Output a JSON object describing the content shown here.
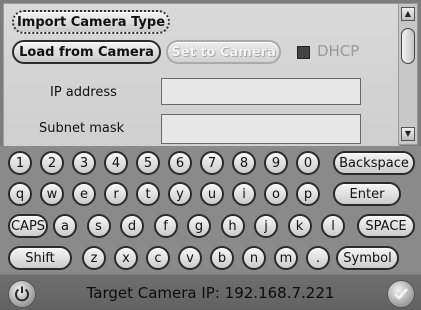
{
  "buttons": {
    "import_camera_type": "Import Camera Type",
    "load_from_camera": "Load from Camera",
    "set_to_camera": "Set to Camera"
  },
  "dhcp": {
    "label": "DHCP",
    "checked": false
  },
  "fields": {
    "ip_address": {
      "label": "IP address",
      "value": ""
    },
    "subnet_mask": {
      "label": "Subnet mask",
      "value": ""
    }
  },
  "keyboard": {
    "row1": [
      "1",
      "2",
      "3",
      "4",
      "5",
      "6",
      "7",
      "8",
      "9",
      "0"
    ],
    "backspace": "Backspace",
    "row2": [
      "q",
      "w",
      "e",
      "r",
      "t",
      "y",
      "u",
      "i",
      "o",
      "p"
    ],
    "enter": "Enter",
    "caps": "CAPS",
    "row3": [
      "a",
      "s",
      "d",
      "f",
      "g",
      "h",
      "j",
      "k",
      "l"
    ],
    "space": "SPACE",
    "shift": "Shift",
    "row4": [
      "z",
      "x",
      "c",
      "v",
      "b",
      "n",
      "m",
      "."
    ],
    "symbol": "Symbol"
  },
  "status": {
    "text": "Target Camera IP: 192.168.7.221"
  },
  "icons": {
    "left": "power-icon",
    "right": "confirm-icon"
  }
}
